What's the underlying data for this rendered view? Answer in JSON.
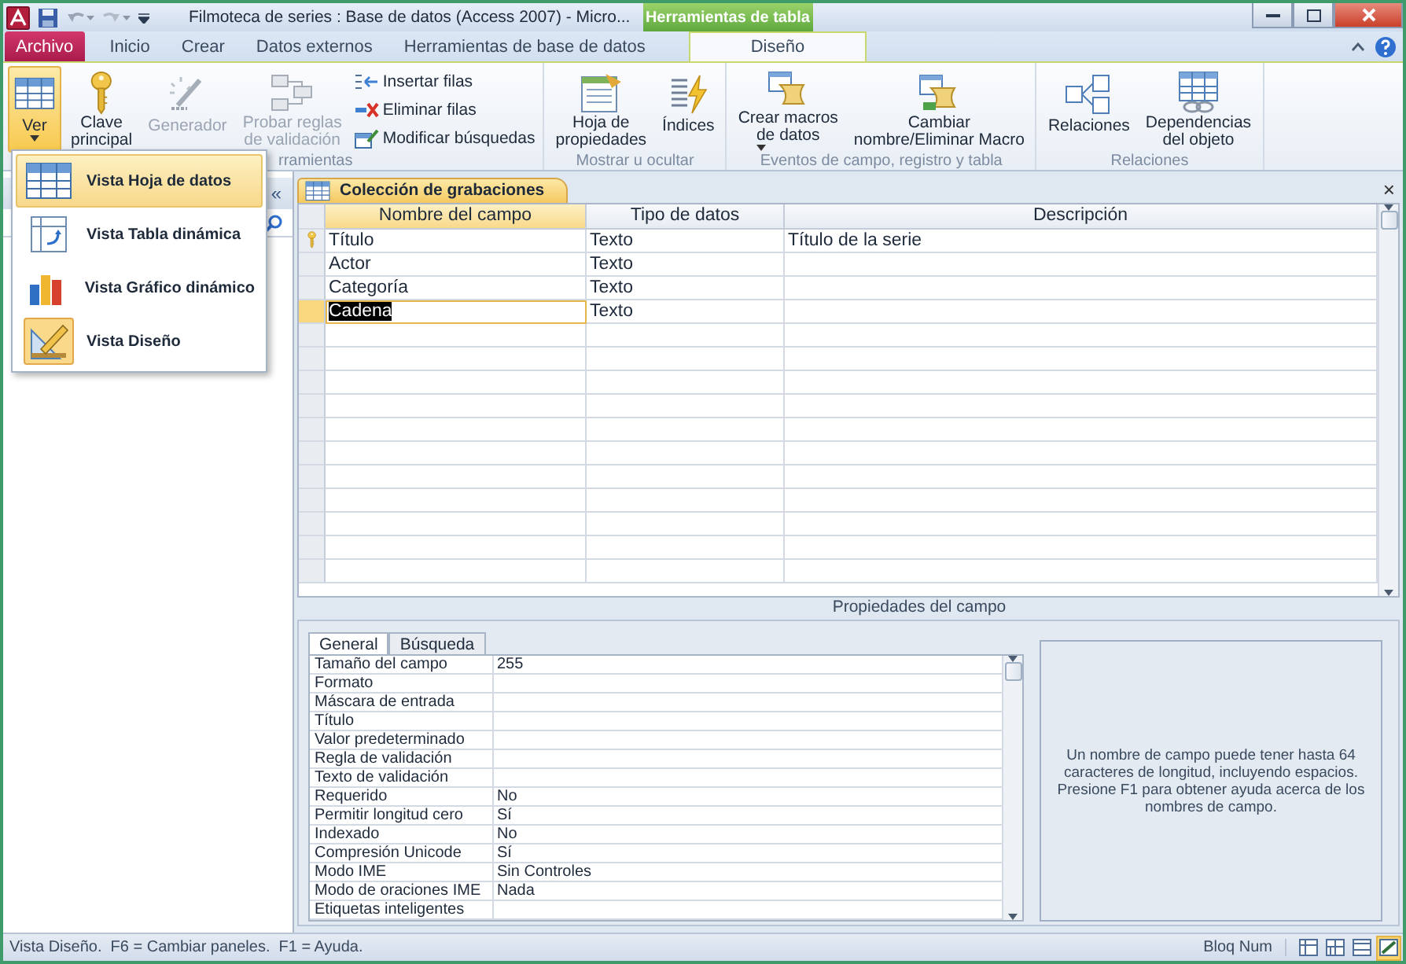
{
  "title_bar": {
    "title": "Filmoteca de series : Base de datos (Access 2007)  -  Micro...",
    "context_group": "Herramientas de tabla"
  },
  "ribbon_tabs": [
    {
      "label": "Archivo",
      "kind": "file",
      "selected": false
    },
    {
      "label": "Inicio",
      "kind": "tab",
      "selected": false
    },
    {
      "label": "Crear",
      "kind": "tab",
      "selected": false
    },
    {
      "label": "Datos externos",
      "kind": "tab",
      "selected": false
    },
    {
      "label": "Herramientas de base de datos",
      "kind": "tab",
      "selected": false
    },
    {
      "label": "Diseño",
      "kind": "tab",
      "selected": true
    }
  ],
  "ribbon_groups": [
    {
      "label": "rramientas",
      "items": [
        {
          "kind": "large",
          "label_lines": [
            "Ver"
          ],
          "dropdown": true,
          "selected": true,
          "disabled": false
        },
        {
          "kind": "large",
          "label_lines": [
            "Clave",
            "principal"
          ],
          "dropdown": false,
          "selected": false,
          "disabled": false
        },
        {
          "kind": "large",
          "label_lines": [
            "Generador"
          ],
          "dropdown": false,
          "selected": false,
          "disabled": true
        },
        {
          "kind": "large",
          "label_lines": [
            "Probar reglas",
            "de validación"
          ],
          "dropdown": false,
          "selected": false,
          "disabled": true
        },
        {
          "kind": "stack",
          "items": [
            {
              "label": "Insertar filas"
            },
            {
              "label": "Eliminar filas"
            },
            {
              "label": "Modificar búsquedas"
            }
          ]
        }
      ]
    },
    {
      "label": "Mostrar u ocultar",
      "items": [
        {
          "kind": "large",
          "label_lines": [
            "Hoja de",
            "propiedades"
          ],
          "dropdown": false,
          "selected": false,
          "disabled": false
        },
        {
          "kind": "large",
          "label_lines": [
            "Índices"
          ],
          "dropdown": false,
          "selected": false,
          "disabled": false
        }
      ]
    },
    {
      "label": "Eventos de campo, registro y tabla",
      "items": [
        {
          "kind": "large",
          "label_lines": [
            "Crear macros",
            "de datos"
          ],
          "dropdown": true,
          "selected": false,
          "disabled": false
        },
        {
          "kind": "large",
          "label_lines": [
            "Cambiar",
            "nombre/Eliminar Macro"
          ],
          "dropdown": false,
          "selected": false,
          "disabled": false
        }
      ]
    },
    {
      "label": "Relaciones",
      "items": [
        {
          "kind": "large",
          "label_lines": [
            "Relaciones"
          ],
          "dropdown": false,
          "selected": false,
          "disabled": false
        },
        {
          "kind": "large",
          "label_lines": [
            "Dependencias",
            "del objeto"
          ],
          "dropdown": false,
          "selected": false,
          "disabled": false
        }
      ]
    }
  ],
  "view_menu": [
    {
      "label": "Vista Hoja de datos",
      "highlighted": true,
      "current": false
    },
    {
      "label": "Vista Tabla dinámica",
      "highlighted": false,
      "current": false
    },
    {
      "label": "Vista Gráfico dinámico",
      "highlighted": false,
      "current": false
    },
    {
      "label": "Vista Diseño",
      "highlighted": false,
      "current": true
    }
  ],
  "navigation_pane": {
    "collapse": "«"
  },
  "document_tab": {
    "title": "Colección de grabaciones",
    "close": "×"
  },
  "field_grid": {
    "columns": [
      {
        "label": "Nombre del campo",
        "selected": true
      },
      {
        "label": "Tipo de datos",
        "selected": false
      },
      {
        "label": "Descripción",
        "selected": false
      }
    ],
    "rows": [
      {
        "name": "Título",
        "type": "Texto",
        "description": "Título de la serie",
        "primary_key": true,
        "selected": false
      },
      {
        "name": "Actor",
        "type": "Texto",
        "primary_key": false,
        "selected": false
      },
      {
        "name": "Categoría",
        "type": "Texto",
        "primary_key": false,
        "selected": false
      },
      {
        "name": "Cadena",
        "type": "Texto",
        "primary_key": false,
        "selected": true
      }
    ]
  },
  "field_properties": {
    "title": "Propiedades del campo",
    "tabs": [
      {
        "label": "General",
        "selected": true
      },
      {
        "label": "Búsqueda",
        "selected": false
      }
    ],
    "rows": [
      {
        "label": "Tamaño del campo",
        "value": "255"
      },
      {
        "label": "Formato"
      },
      {
        "label": "Máscara de entrada"
      },
      {
        "label": "Título"
      },
      {
        "label": "Valor predeterminado"
      },
      {
        "label": "Regla de validación"
      },
      {
        "label": "Texto de validación"
      },
      {
        "label": "Requerido",
        "value": "No"
      },
      {
        "label": "Permitir longitud cero",
        "value": "Sí"
      },
      {
        "label": "Indexado",
        "value": "No"
      },
      {
        "label": "Compresión Unicode",
        "value": "Sí"
      },
      {
        "label": "Modo IME",
        "value": "Sin Controles"
      },
      {
        "label": "Modo de oraciones IME",
        "value": "Nada"
      },
      {
        "label": "Etiquetas inteligentes"
      }
    ],
    "help": "Un nombre de campo puede tener hasta 64 caracteres de longitud, incluyendo espacios. Presione F1 para obtener ayuda acerca de los nombres de campo."
  },
  "status_bar": {
    "text": "Vista Diseño.  F6 = Cambiar paneles.  F1 = Ayuda.",
    "num_lock": "Bloq Num",
    "views": [
      {
        "selected": false
      },
      {
        "selected": false
      },
      {
        "selected": false
      },
      {
        "selected": true
      }
    ]
  }
}
